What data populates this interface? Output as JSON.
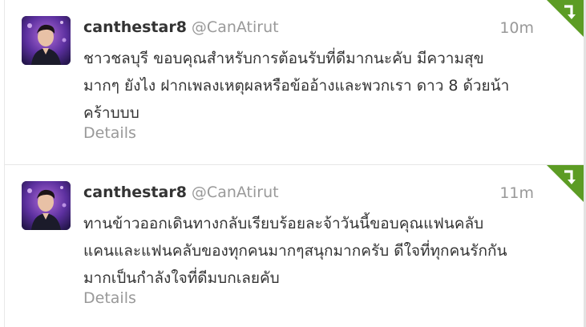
{
  "tweets": [
    {
      "fullname": "canthestar8",
      "username": "@CanAtirut",
      "time": "10m",
      "text_lines": [
        "ชาวชลบุรี ขอบคุณสำหรับการต้อนรับที่ดีมากนะคับ มีความสุข",
        "มากๆ ยังไง ฝากเพลงเหตุผลหรือข้ออ้างและพวกเรา ดาว 8 ด้วยน้า",
        "คร้าบบบ"
      ],
      "details_label": "Details"
    },
    {
      "fullname": "canthestar8",
      "username": "@CanAtirut",
      "time": "11m",
      "text_lines": [
        "ทานข้าวออกเดินทางกลับเรียบร้อยละจ้าวันนี้ขอบคุณแฟนคลับ",
        "แคนและแฟนคลับของทุกคนมากๆสนุกมากครับ ดีใจที่ทุกคนรักกัน",
        "มากเป็นกำลังใจที่ดีมบกเลยคับ"
      ],
      "details_label": "Details"
    }
  ],
  "icons": {
    "retweet_corner": "retweet-corner-icon",
    "avatar": "avatar"
  },
  "colors": {
    "retweet_green": "#5c9c24",
    "name": "#333333",
    "muted": "#999999"
  }
}
